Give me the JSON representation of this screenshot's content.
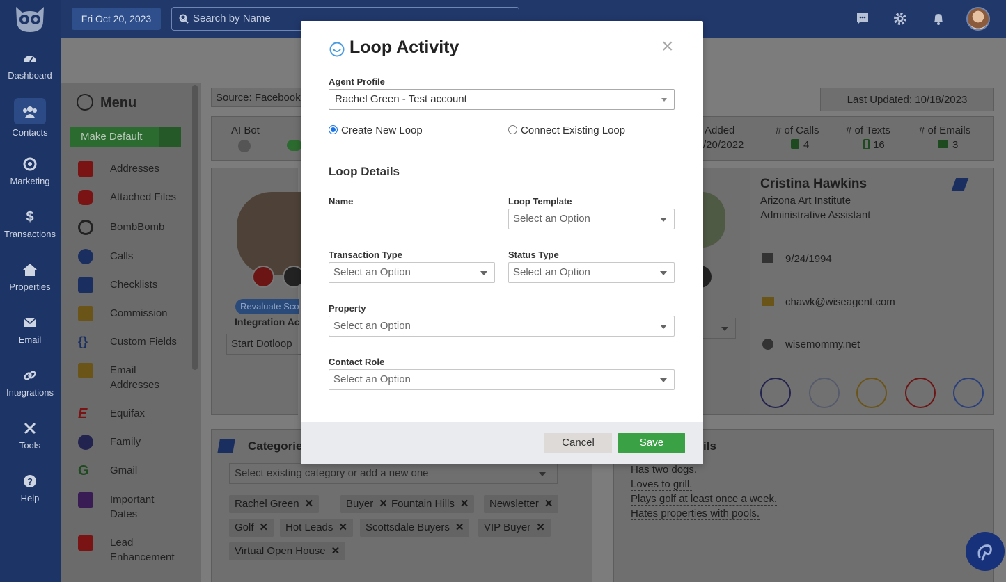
{
  "topbar": {
    "date": "Fri Oct 20, 2023",
    "search_placeholder": "Search by Name"
  },
  "nav": {
    "items": [
      {
        "label": "Dashboard",
        "icon": "dashboard-icon"
      },
      {
        "label": "Contacts",
        "icon": "users-icon"
      },
      {
        "label": "Marketing",
        "icon": "marketing-icon"
      },
      {
        "label": "Transactions",
        "icon": "dollar-icon"
      },
      {
        "label": "Properties",
        "icon": "home-icon"
      },
      {
        "label": "Email",
        "icon": "envelope-icon"
      },
      {
        "label": "Integrations",
        "icon": "link-icon"
      },
      {
        "label": "Tools",
        "icon": "tools-icon"
      },
      {
        "label": "Help",
        "icon": "help-icon"
      }
    ]
  },
  "menu": {
    "title": "Menu",
    "make_default": "Make Default",
    "items": [
      {
        "label": "Addresses",
        "color": "#c41e1e"
      },
      {
        "label": "Attached Files",
        "color": "#c41e1e"
      },
      {
        "label": "BombBomb",
        "color": "#222222"
      },
      {
        "label": "Calls",
        "color": "#1a4fb5"
      },
      {
        "label": "Checklists",
        "color": "#1a4fb5"
      },
      {
        "label": "Commission",
        "color": "#b8860b"
      },
      {
        "label": "Custom Fields",
        "color": "#1a4fb5"
      },
      {
        "label": "Email Addresses",
        "color": "#b8860b"
      },
      {
        "label": "Equifax",
        "color": "#c41e1e"
      },
      {
        "label": "Family",
        "color": "#3a3a8c"
      },
      {
        "label": "Gmail",
        "color": "#2f7d32"
      },
      {
        "label": "Important Dates",
        "color": "#5b2c83"
      },
      {
        "label": "Lead Enhancement",
        "color": "#c41e1e"
      }
    ]
  },
  "background": {
    "source": "Source: Facebook",
    "last_updated": "Last Updated: 10/18/2023",
    "stats": [
      {
        "label": "AI Bot",
        "value": ""
      },
      {
        "label": "Added",
        "value": "/20/2022"
      },
      {
        "label": "# of Calls",
        "value": "4"
      },
      {
        "label": "# of Texts",
        "value": "16"
      },
      {
        "label": "# of Emails",
        "value": "3"
      }
    ],
    "revaluate": "Revaluate Scor",
    "integration": "Integration Ac",
    "start_dotloop": "Start Dotloop",
    "contact": {
      "name": "Cristina Hawkins",
      "company": "Arizona Art Institute",
      "title": "Administrative Assistant",
      "birthday": "9/24/1994",
      "email": "chawk@wiseagent.com",
      "website": "wisemommy.net"
    },
    "categories_title": "Categorie",
    "details_title": "ils",
    "category_placeholder": "Select existing category or add a new one",
    "chips": [
      "Rachel Green",
      "Buyer",
      "Fountain Hills",
      "Newsletter",
      "Golf",
      "Hot Leads",
      "Scottsdale Buyers",
      "VIP Buyer",
      "Virtual Open House"
    ],
    "notes": [
      "Has two dogs.",
      "Loves to grill.",
      "Plays golf at least once a week.",
      "Hates properties with pools."
    ]
  },
  "modal": {
    "title": "Loop Activity",
    "close": "×",
    "agent_profile_label": "Agent Profile",
    "agent_profile_value": "Rachel Green - Test account",
    "radio_new": "Create New Loop",
    "radio_existing": "Connect Existing Loop",
    "section": "Loop Details",
    "name_label": "Name",
    "loop_template_label": "Loop Template",
    "transaction_type_label": "Transaction Type",
    "status_type_label": "Status Type",
    "property_label": "Property",
    "contact_role_label": "Contact Role",
    "select_placeholder": "Select an Option",
    "cancel": "Cancel",
    "save": "Save"
  }
}
